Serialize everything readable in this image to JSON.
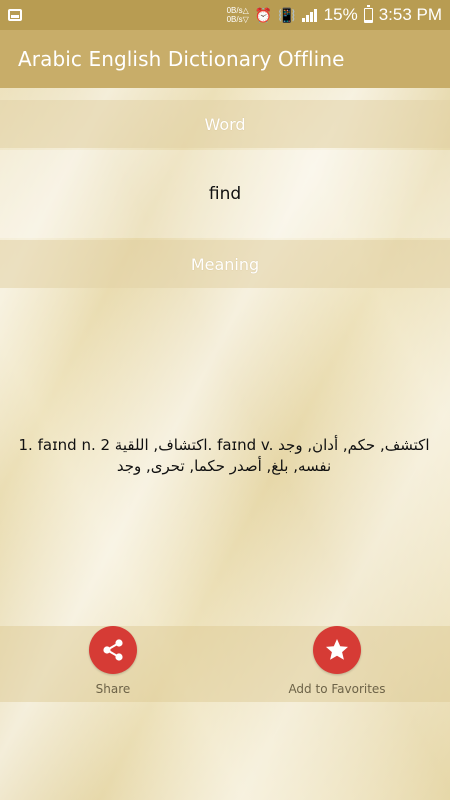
{
  "status_bar": {
    "net_up": "0B/s",
    "net_down": "0B/s",
    "up_arrow": "△",
    "down_arrow": "▽",
    "battery": "15%",
    "time": "3:53 PM"
  },
  "app_bar": {
    "title": "Arabic English Dictionary Offline"
  },
  "word_section": {
    "label": "Word",
    "value": "find"
  },
  "meaning_section": {
    "label": "Meaning",
    "text": "1. faɪnd n. 2 اكتشاف, اللقية. faɪnd v. اكتشف, حكم, أدان, وجد نفسه, بلغ, أصدر حكما, تحرى, وجد"
  },
  "actions": {
    "share_label": "Share",
    "favorites_label": "Add to Favorites"
  },
  "colors": {
    "status_bar": "#b89c52",
    "app_bar": "#c8ad69",
    "action_circle": "#d63b35"
  }
}
